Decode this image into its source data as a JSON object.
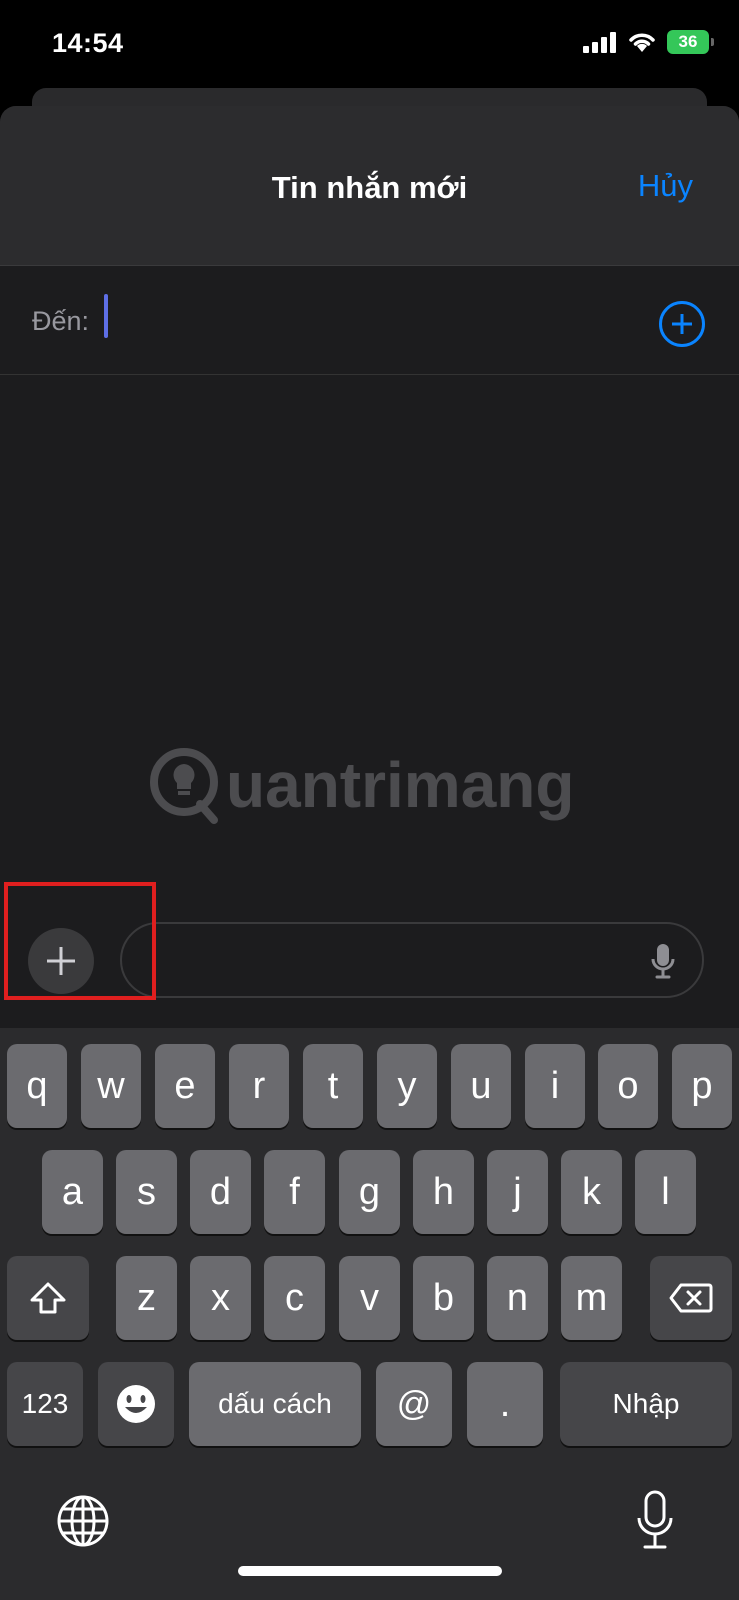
{
  "status_bar": {
    "time": "14:54",
    "battery": "36"
  },
  "header": {
    "title": "Tin nhắn mới",
    "cancel_label": "Hủy"
  },
  "to_field": {
    "label": "Đến:"
  },
  "watermark": {
    "text": "uantrimang"
  },
  "keyboard": {
    "row1": [
      "q",
      "w",
      "e",
      "r",
      "t",
      "y",
      "u",
      "i",
      "o",
      "p"
    ],
    "row2": [
      "a",
      "s",
      "d",
      "f",
      "g",
      "h",
      "j",
      "k",
      "l"
    ],
    "row3": [
      "z",
      "x",
      "c",
      "v",
      "b",
      "n",
      "m"
    ],
    "numbers_label": "123",
    "space_label": "dấu cách",
    "at_label": "@",
    "dot_label": ".",
    "return_label": "Nhập"
  },
  "colors": {
    "accent": "#0a84ff",
    "highlight": "#e01f1f",
    "battery": "#34c759"
  }
}
